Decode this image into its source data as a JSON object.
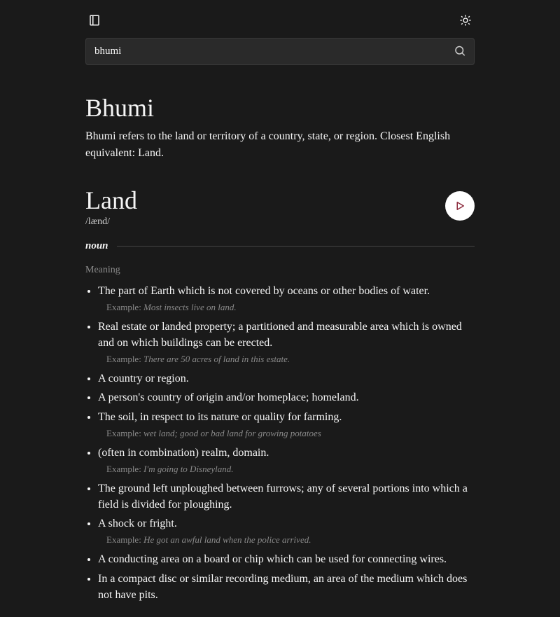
{
  "search": {
    "value": "bhumi",
    "placeholder": ""
  },
  "headword": "Bhumi",
  "summary": "Bhumi refers to the land or territory of a country, state, or region. Closest English equivalent: Land.",
  "entry": {
    "word": "Land",
    "phonetic": "/lænd/",
    "pos": "noun",
    "meaning_label": "Meaning",
    "example_prefix": "Example: ",
    "definitions": [
      {
        "text": "The part of Earth which is not covered by oceans or other bodies of water.",
        "example": "Most insects live on land."
      },
      {
        "text": "Real estate or landed property; a partitioned and measurable area which is owned and on which buildings can be erected.",
        "example": "There are 50 acres of land in this estate."
      },
      {
        "text": "A country or region."
      },
      {
        "text": "A person's country of origin and/or homeplace; homeland."
      },
      {
        "text": "The soil, in respect to its nature or quality for farming.",
        "example": "wet land; good or bad land for growing potatoes"
      },
      {
        "text": "(often in combination) realm, domain.",
        "example": "I'm going to Disneyland."
      },
      {
        "text": "The ground left unploughed between furrows; any of several portions into which a field is divided for ploughing."
      },
      {
        "text": "A shock or fright.",
        "example": "He got an awful land when the police arrived."
      },
      {
        "text": "A conducting area on a board or chip which can be used for connecting wires."
      },
      {
        "text": "In a compact disc or similar recording medium, an area of the medium which does not have pits."
      }
    ]
  }
}
